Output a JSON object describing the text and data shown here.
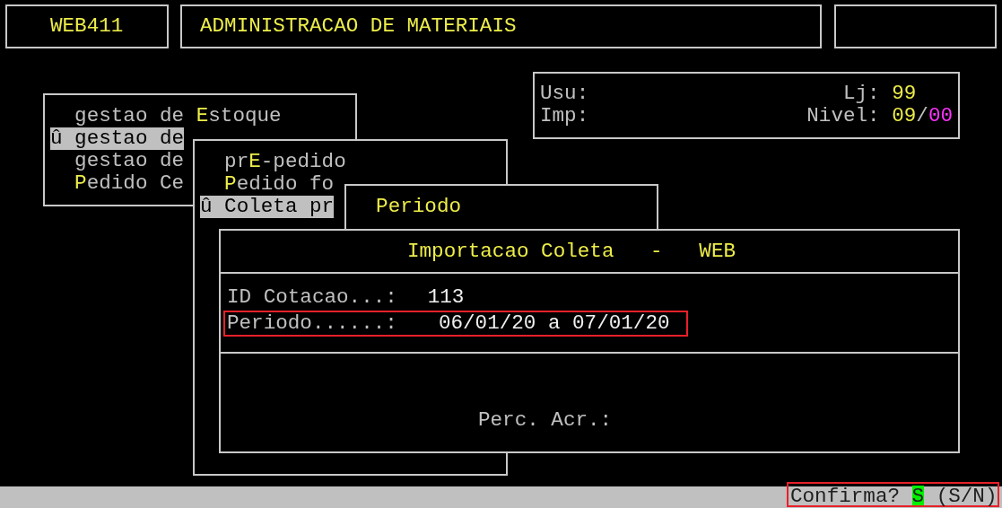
{
  "header": {
    "program_code": "WEB411",
    "system_title": "ADMINISTRACAO DE MATERIAIS"
  },
  "user_info": {
    "user_label": "Usu:",
    "printer_label": "Imp:",
    "store_label": "Lj:",
    "store_value": "99",
    "level_label": "Nivel:",
    "level_value": "09",
    "level_separator": "/",
    "level_subvalue": "00"
  },
  "menus": [
    {
      "items": [
        {
          "selected": false,
          "parts": [
            {
              "text": "gestao de ",
              "hot": false
            },
            {
              "text": "E",
              "hot": true
            },
            {
              "text": "stoque",
              "hot": false
            }
          ]
        },
        {
          "selected": true,
          "parts": [
            {
              "text": "û gestao de",
              "hot": false
            }
          ]
        },
        {
          "selected": false,
          "parts": [
            {
              "text": "gestao de",
              "hot": false
            }
          ]
        },
        {
          "selected": false,
          "parts": [
            {
              "text": "P",
              "hot": true
            },
            {
              "text": "edido Ce",
              "hot": false
            }
          ]
        }
      ]
    },
    {
      "items": [
        {
          "selected": false,
          "parts": [
            {
              "text": "pr",
              "hot": false
            },
            {
              "text": "E",
              "hot": true
            },
            {
              "text": "-pedido",
              "hot": false
            }
          ]
        },
        {
          "selected": false,
          "parts": [
            {
              "text": "P",
              "hot": true
            },
            {
              "text": "edido fo",
              "hot": false
            }
          ]
        },
        {
          "selected": true,
          "parts": [
            {
              "text": "û Coleta pr",
              "hot": false
            }
          ]
        }
      ]
    },
    {
      "items": [
        {
          "selected": false,
          "parts": [
            {
              "text": "Periodo",
              "hot": true
            }
          ]
        }
      ]
    }
  ],
  "dialog": {
    "title": "Importacao Coleta   -   WEB",
    "fields": [
      {
        "label": "ID Cotacao...:",
        "value": "113",
        "highlighted": false
      },
      {
        "label": "Periodo......:",
        "value": "06/01/20 a 07/01/20",
        "highlighted": true
      }
    ],
    "perc_label": "Perc. Acr.:"
  },
  "status_bar": {
    "prompt": "Confirma?",
    "answer": "S",
    "options": "(S/N)",
    "highlighted": true
  }
}
